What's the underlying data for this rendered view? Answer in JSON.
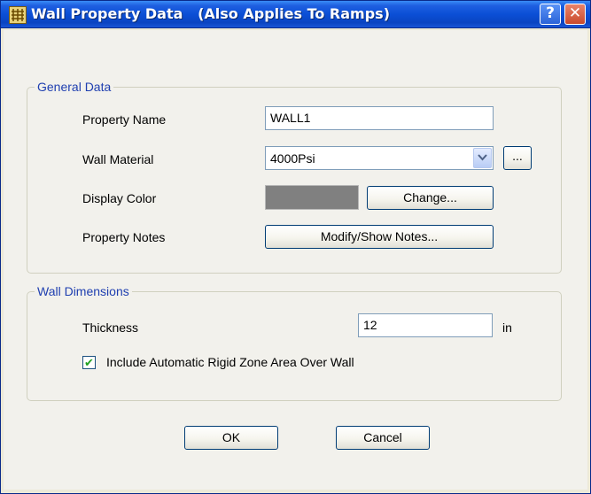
{
  "window": {
    "title": "Wall Property Data   (Also Applies To Ramps)",
    "help_label": "?",
    "close_label": "✕"
  },
  "general_data": {
    "group_label": "General Data",
    "property_name_label": "Property Name",
    "property_name_value": "WALL1",
    "wall_material_label": "Wall Material",
    "wall_material_value": "4000Psi",
    "wall_material_dropdown_icon": "chevron-down",
    "ellipsis_label": "...",
    "display_color_label": "Display Color",
    "display_color_value": "#808080",
    "change_label": "Change...",
    "property_notes_label": "Property Notes",
    "modify_notes_label": "Modify/Show Notes..."
  },
  "wall_dimensions": {
    "group_label": "Wall Dimensions",
    "thickness_label": "Thickness",
    "thickness_value": "12",
    "thickness_unit": "in",
    "rigid_zone_label": "Include Automatic Rigid Zone Area Over Wall",
    "rigid_zone_checked": true,
    "check_mark": "✔"
  },
  "buttons": {
    "ok_label": "OK",
    "cancel_label": "Cancel"
  }
}
